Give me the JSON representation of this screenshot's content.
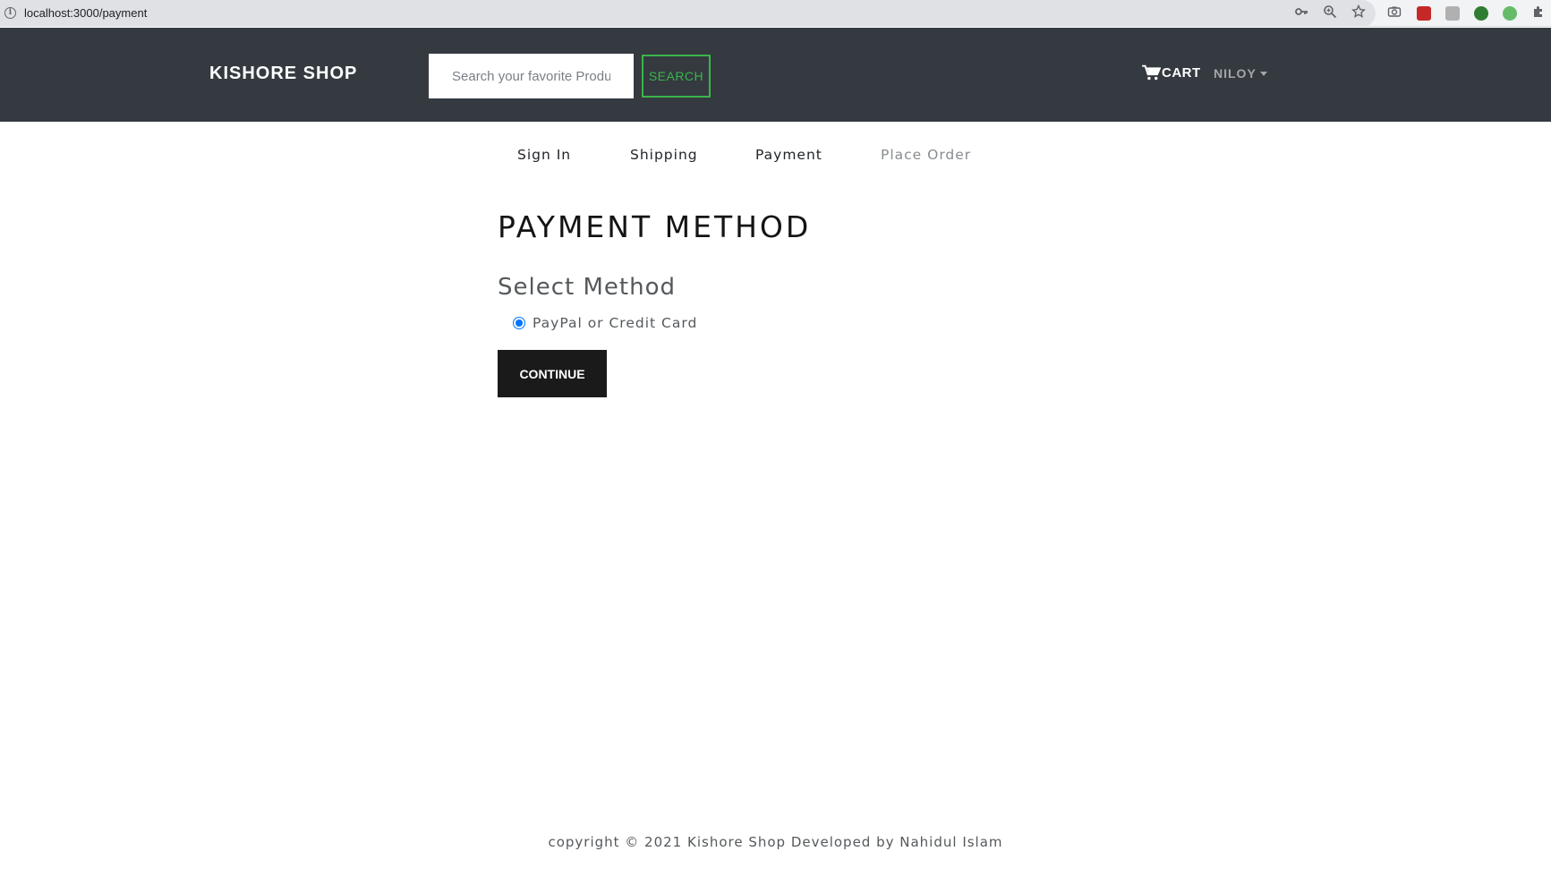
{
  "browser": {
    "url": "localhost:3000/payment",
    "info_symbol": "i"
  },
  "navbar": {
    "brand": "KISHORE SHOP",
    "search_placeholder": "Search your favorite Products",
    "search_button": "SEARCH",
    "cart_label": "CART",
    "user_label": "NILOY"
  },
  "steps": [
    {
      "label": "Sign In",
      "enabled": true
    },
    {
      "label": "Shipping",
      "enabled": true
    },
    {
      "label": "Payment",
      "enabled": true
    },
    {
      "label": "Place Order",
      "enabled": false
    }
  ],
  "main": {
    "title": "PAYMENT METHOD",
    "section_title": "Select Method",
    "payment_option": {
      "label": "PayPal or Credit Card",
      "checked": true
    },
    "continue_button": "CONTINUE"
  },
  "footer": {
    "text": "copyright © 2021 Kishore Shop Developed by Nahidul Islam"
  },
  "colors": {
    "navbar_bg": "#343a40",
    "search_accent": "#3bb54a",
    "radio_accent": "#0075ff",
    "continue_bg": "#1a1a1a"
  }
}
